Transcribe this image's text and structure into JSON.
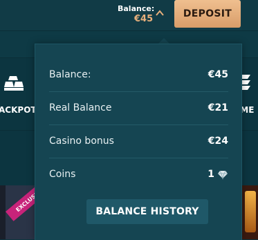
{
  "header": {
    "balance_label": "Balance:",
    "balance_amount": "€45",
    "deposit_label": "DEPOSIT"
  },
  "categories": {
    "left_label": "ACKPOTS",
    "right_label": "AME"
  },
  "tiles": {
    "exclusive_badge": "EXCLUSIV"
  },
  "balance_panel": {
    "rows": [
      {
        "label": "Balance:",
        "value": "€45"
      },
      {
        "label": "Real Balance",
        "value": "€21"
      },
      {
        "label": "Casino bonus",
        "value": "€24"
      },
      {
        "label": "Coins",
        "value": "1"
      }
    ],
    "history_button": "BALANCE HISTORY"
  },
  "colors": {
    "background": "#0c3540",
    "panel": "#154552",
    "accent_gold": "#e8b07c",
    "deposit_button": "#e3ad7c"
  },
  "icons": {
    "toggle": "chevron-up-icon",
    "coins": "diamond-icon",
    "category_left": "gold-bars-icon",
    "category_right": "stack-icon"
  }
}
